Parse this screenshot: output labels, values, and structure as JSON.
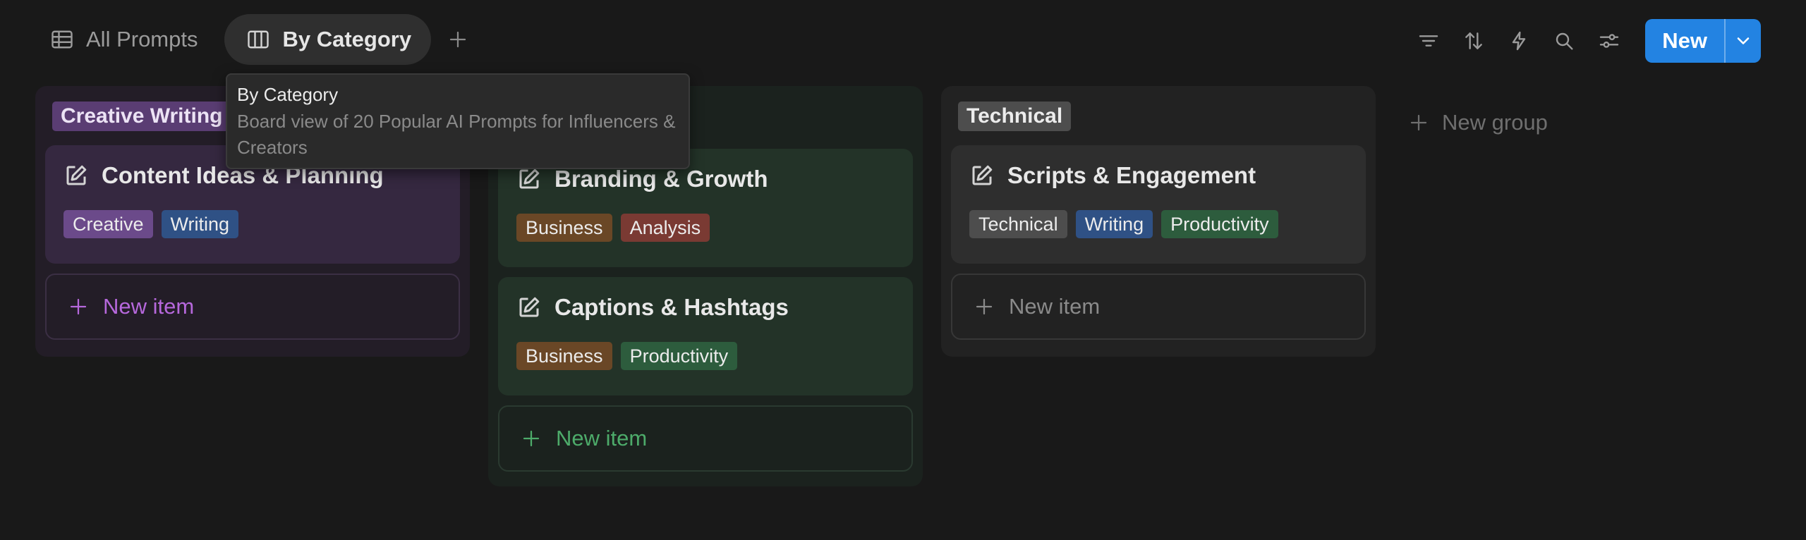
{
  "views": {
    "tabs": [
      {
        "label": "All Prompts",
        "icon": "table-icon"
      },
      {
        "label": "By Category",
        "icon": "board-icon"
      }
    ],
    "add_icon": "plus-icon"
  },
  "toolbar": {
    "icons": [
      "filter-icon",
      "sort-icon",
      "lightning-icon",
      "search-icon",
      "settings-sliders-icon"
    ],
    "new_label": "New",
    "accent": "#2383e2"
  },
  "tooltip": {
    "title": "By Category",
    "description": "Board view of 20 Popular AI Prompts for Influencers & Creators"
  },
  "board": {
    "columns": [
      {
        "label": "Creative Writing",
        "color": "#5a3d73",
        "cards": [
          {
            "title": "Content Ideas & Planning",
            "tags": [
              "Creative",
              "Writing"
            ]
          }
        ],
        "new_item_label": "New item"
      },
      {
        "label": "",
        "color": "#233328",
        "cards": [
          {
            "title": "Branding & Growth",
            "tags": [
              "Business",
              "Analysis"
            ]
          },
          {
            "title": "Captions & Hashtags",
            "tags": [
              "Business",
              "Productivity"
            ]
          }
        ],
        "new_item_label": "New item"
      },
      {
        "label": "Technical",
        "color": "#4d4d4d",
        "cards": [
          {
            "title": "Scripts & Engagement",
            "tags": [
              "Technical",
              "Writing",
              "Productivity"
            ]
          }
        ],
        "new_item_label": "New item"
      }
    ],
    "new_group_label": "New group"
  }
}
